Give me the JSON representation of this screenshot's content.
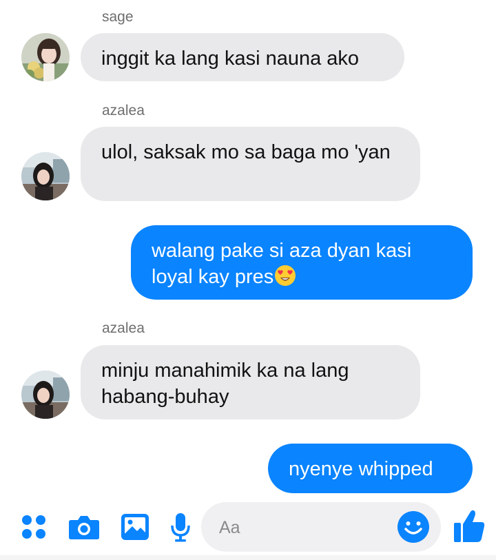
{
  "colors": {
    "accent": "#0a84ff",
    "incoming_bubble": "#e9e9eb",
    "input_bg": "#f0f0f2"
  },
  "messages": [
    {
      "sender": "sage",
      "direction": "incoming",
      "text": "inggit ka lang kasi nauna ako"
    },
    {
      "sender": "azalea",
      "direction": "incoming",
      "text": "ulol, saksak mo sa baga mo 'yan"
    },
    {
      "direction": "outgoing",
      "text": "walang pake si aza dyan kasi loyal kay pres",
      "emoji": "heart-eyes-emoji"
    },
    {
      "sender": "azalea",
      "direction": "incoming",
      "text": "minju manahimik ka na lang habang-buhay"
    },
    {
      "direction": "outgoing",
      "text": "nyenye whipped"
    }
  ],
  "composer": {
    "placeholder": "Aa",
    "icons": [
      "apps-icon",
      "camera-icon",
      "gallery-icon",
      "microphone-icon",
      "emoji-icon",
      "thumbs-up-icon"
    ]
  }
}
